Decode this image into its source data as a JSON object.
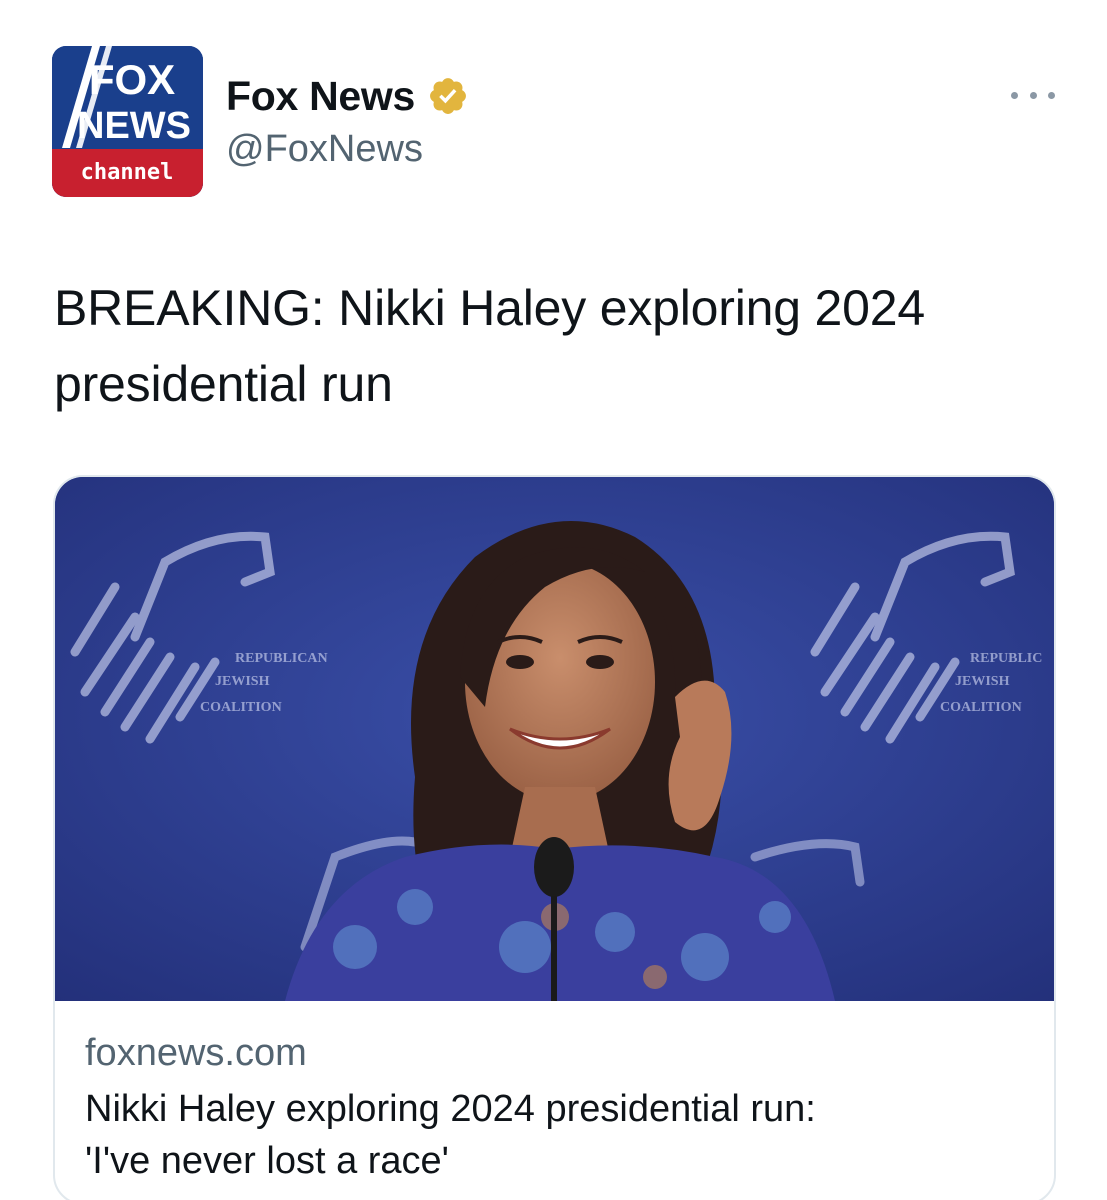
{
  "account": {
    "display_name": "Fox News",
    "handle": "@FoxNews",
    "verified": true,
    "avatar_text": {
      "line1": "FOX",
      "line2": "NEWS",
      "line3": "channel"
    }
  },
  "tweet": {
    "text": "BREAKING: Nikki Haley exploring 2024 presidential run"
  },
  "card": {
    "domain": "foxnews.com",
    "title_line1": "Nikki Haley exploring 2024 presidential run:",
    "title_line2": "'I've never lost a race'",
    "backdrop_text_left": [
      "REPUBLICAN",
      "JEWISH",
      "COALITION"
    ],
    "backdrop_text_right": [
      "REPUBLIC",
      "JEWISH",
      "COALITION"
    ]
  },
  "colors": {
    "brand_blue": "#1a3f8c",
    "brand_red": "#c8202f",
    "verified_gold": "#e2b53e",
    "backdrop_blue": "#2e3f94",
    "secondary_text": "#536471"
  },
  "icons": {
    "more": "ellipsis-icon",
    "verified": "verified-badge-icon"
  }
}
